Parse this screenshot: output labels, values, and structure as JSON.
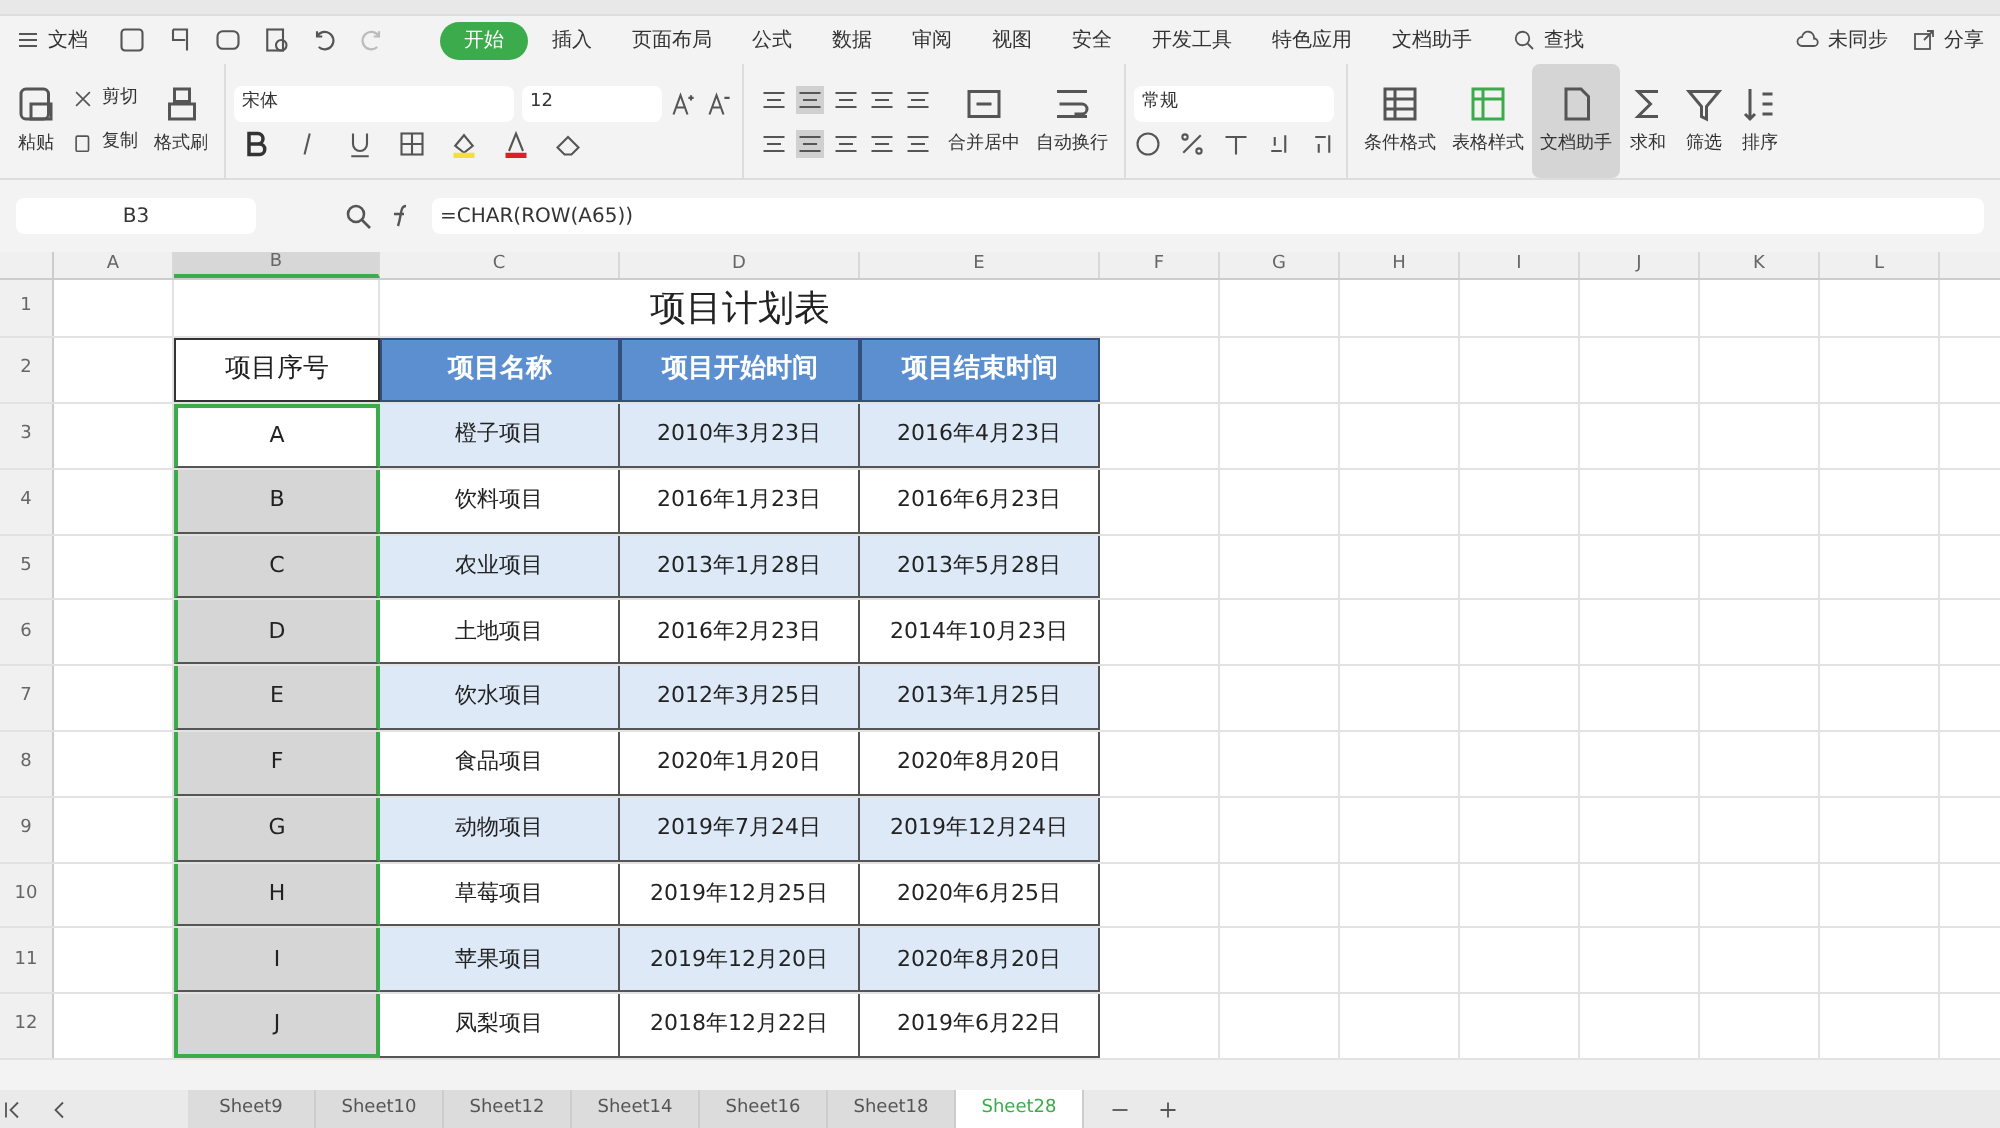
{
  "menu": {
    "file_label": "文档",
    "tabs": [
      {
        "label": "开始",
        "selected": true
      },
      {
        "label": "插入",
        "selected": false
      },
      {
        "label": "页面布局",
        "selected": false
      },
      {
        "label": "公式",
        "selected": false
      },
      {
        "label": "数据",
        "selected": false
      },
      {
        "label": "审阅",
        "selected": false
      },
      {
        "label": "视图",
        "selected": false
      },
      {
        "label": "安全",
        "selected": false
      },
      {
        "label": "开发工具",
        "selected": false
      },
      {
        "label": "特色应用",
        "selected": false
      },
      {
        "label": "文档助手",
        "selected": false
      }
    ],
    "search": "查找",
    "sync": "未同步",
    "share": "分享"
  },
  "ribbon": {
    "paste": "粘贴",
    "cut": "剪切",
    "copy": "复制",
    "format_painter": "格式刷",
    "font": "宋体",
    "size": "12",
    "merge": "合并居中",
    "wrap": "自动换行",
    "number_format": "常规",
    "big_tools": [
      {
        "label": "条件格式",
        "selected": false
      },
      {
        "label": "表格样式",
        "selected": false
      },
      {
        "label": "文档助手",
        "selected": true
      },
      {
        "label": "求和",
        "selected": false
      },
      {
        "label": "筛选",
        "selected": false
      },
      {
        "label": "排序",
        "selected": false
      }
    ]
  },
  "formula_bar": {
    "cell": "B3",
    "formula": "=CHAR(ROW(A65))"
  },
  "columns": [
    {
      "label": "A",
      "selected": false
    },
    {
      "label": "B",
      "selected": true
    },
    {
      "label": "C",
      "selected": false
    },
    {
      "label": "D",
      "selected": false
    },
    {
      "label": "E",
      "selected": false
    },
    {
      "label": "F",
      "selected": false
    },
    {
      "label": "G",
      "selected": false
    },
    {
      "label": "H",
      "selected": false
    },
    {
      "label": "I",
      "selected": false
    },
    {
      "label": "J",
      "selected": false
    },
    {
      "label": "K",
      "selected": false
    },
    {
      "label": "L",
      "selected": false
    }
  ],
  "row_headers": [
    "1",
    "2",
    "3",
    "4",
    "5",
    "6",
    "7",
    "8",
    "9",
    "10",
    "11",
    "12"
  ],
  "sheet": {
    "title": "项目计划表",
    "headers": [
      "项目序号",
      "项目名称",
      "项目开始时间",
      "项目结束时间"
    ],
    "rows": [
      [
        "A",
        "橙子项目",
        "2010年3月23日",
        "2016年4月23日"
      ],
      [
        "B",
        "饮料项目",
        "2016年1月23日",
        "2016年6月23日"
      ],
      [
        "C",
        "农业项目",
        "2013年1月28日",
        "2013年5月28日"
      ],
      [
        "D",
        "土地项目",
        "2016年2月23日",
        "2014年10月23日"
      ],
      [
        "E",
        "饮水项目",
        "2012年3月25日",
        "2013年1月25日"
      ],
      [
        "F",
        "食品项目",
        "2020年1月20日",
        "2020年8月20日"
      ],
      [
        "G",
        "动物项目",
        "2019年7月24日",
        "2019年12月24日"
      ],
      [
        "H",
        "草莓项目",
        "2019年12月25日",
        "2020年6月25日"
      ],
      [
        "I",
        "苹果项目",
        "2019年12月20日",
        "2020年8月20日"
      ],
      [
        "J",
        "凤梨项目",
        "2018年12月22日",
        "2019年6月22日"
      ]
    ]
  },
  "sheet_tabs": [
    {
      "label": "Sheet9",
      "selected": false
    },
    {
      "label": "Sheet10",
      "selected": false
    },
    {
      "label": "Sheet12",
      "selected": false
    },
    {
      "label": "Sheet14",
      "selected": false
    },
    {
      "label": "Sheet16",
      "selected": false
    },
    {
      "label": "Sheet18",
      "selected": false
    },
    {
      "label": "Sheet28",
      "selected": true
    }
  ]
}
